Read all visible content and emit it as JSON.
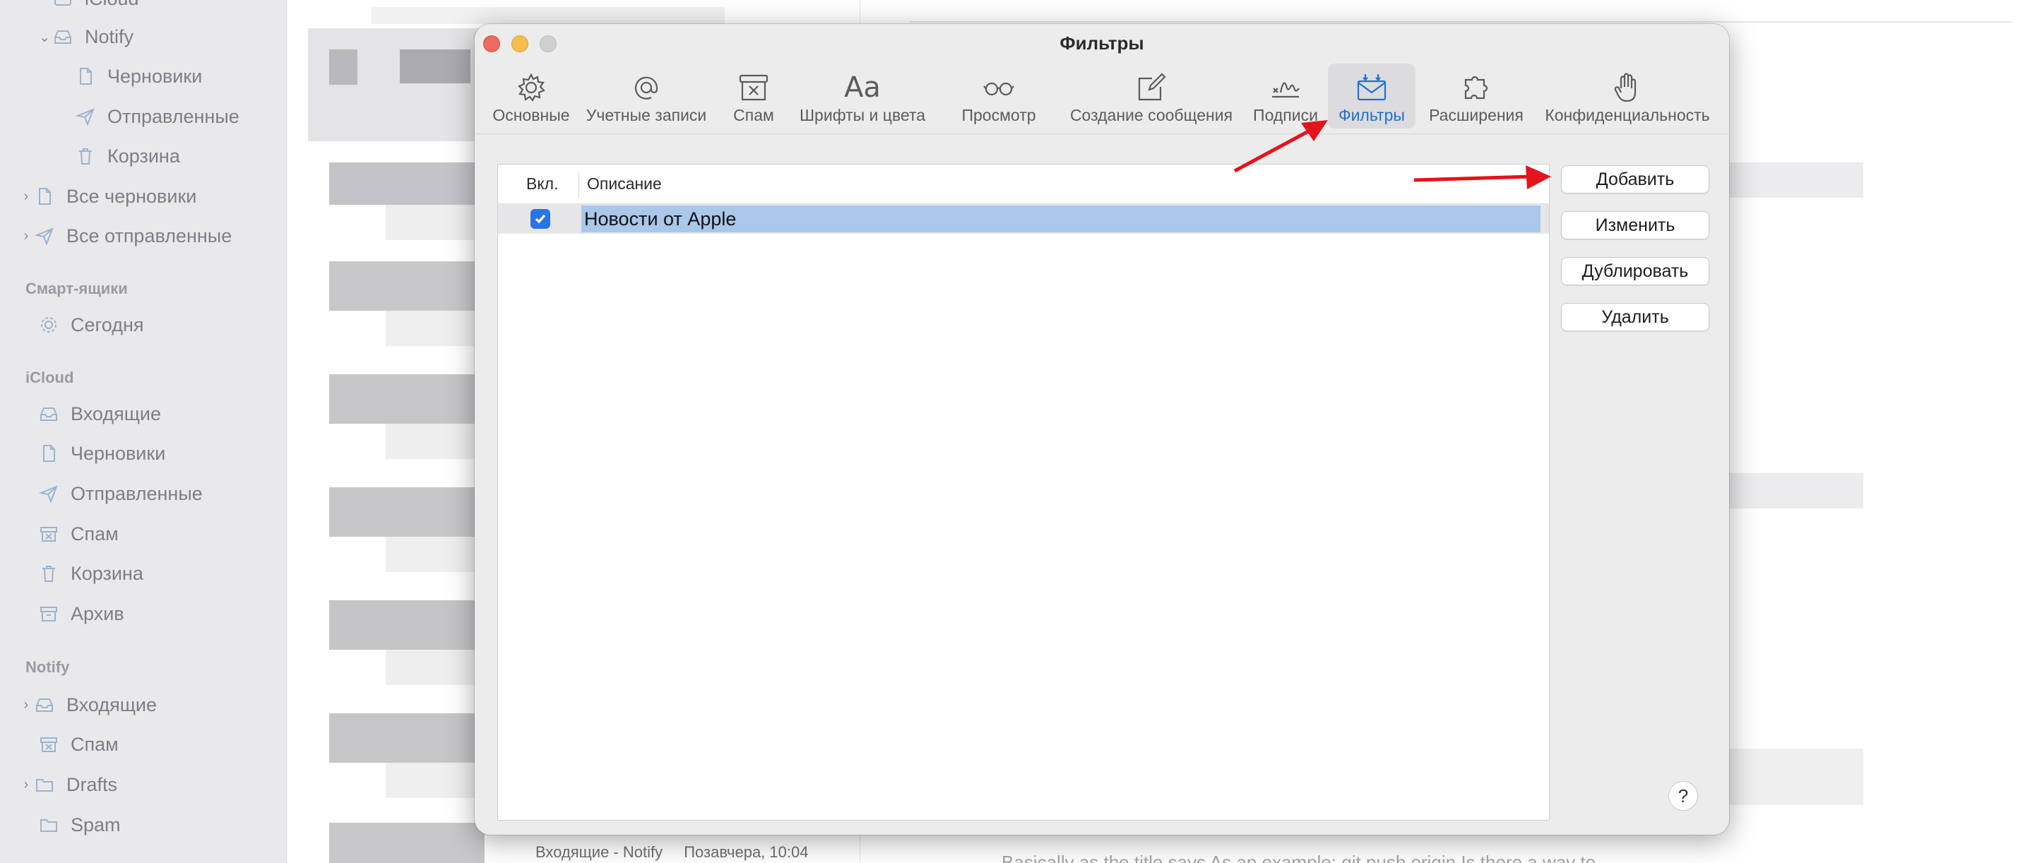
{
  "sidebar": {
    "top_partial": "iCloud",
    "notify_group": {
      "label": "Notify",
      "items": [
        "Черновики",
        "Отправленные",
        "Корзина"
      ]
    },
    "all_drafts": "Все черновики",
    "all_sent": "Все отправленные",
    "smart_header": "Смарт-ящики",
    "smart_items": [
      "Сегодня"
    ],
    "icloud_header": "iCloud",
    "icloud_items": [
      "Входящие",
      "Черновики",
      "Отправленные",
      "Спам",
      "Корзина",
      "Архив"
    ],
    "notify_header": "Notify",
    "notify_items": [
      "Входящие",
      "Спам",
      "Drafts",
      "Spam"
    ]
  },
  "message_list": {
    "footer_mailbox": "Входящие - Notify",
    "footer_date": "Позавчера, 10:04"
  },
  "reader": {
    "partial_text": "Basically as the title says As an example: git push origin Is there a way to"
  },
  "dialog": {
    "title": "Фильтры",
    "toolbar": [
      {
        "label": "Основные",
        "icon": "gear-icon"
      },
      {
        "label": "Учетные записи",
        "icon": "at-icon"
      },
      {
        "label": "Спам",
        "icon": "junk-icon"
      },
      {
        "label": "Шрифты и цвета",
        "icon": "fonts-icon",
        "glyph": "Aa"
      },
      {
        "label": "Просмотр",
        "icon": "glasses-icon"
      },
      {
        "label": "Создание сообщения",
        "icon": "compose-icon"
      },
      {
        "label": "Подписи",
        "icon": "signature-icon"
      },
      {
        "label": "Фильтры",
        "icon": "filters-icon",
        "active": true
      },
      {
        "label": "Расширения",
        "icon": "puzzle-icon"
      },
      {
        "label": "Конфиденциальность",
        "icon": "hand-icon"
      }
    ],
    "table": {
      "col_enabled": "Вкл.",
      "col_description": "Описание",
      "rows": [
        {
          "enabled": true,
          "description": "Новости от Apple"
        }
      ]
    },
    "buttons": {
      "add": "Добавить",
      "edit": "Изменить",
      "duplicate": "Дублировать",
      "delete": "Удалить"
    },
    "help": "?"
  },
  "colors": {
    "accent": "#1f6fd8",
    "selection": "#a9c8ea",
    "annotation_arrow": "#e3141b"
  }
}
